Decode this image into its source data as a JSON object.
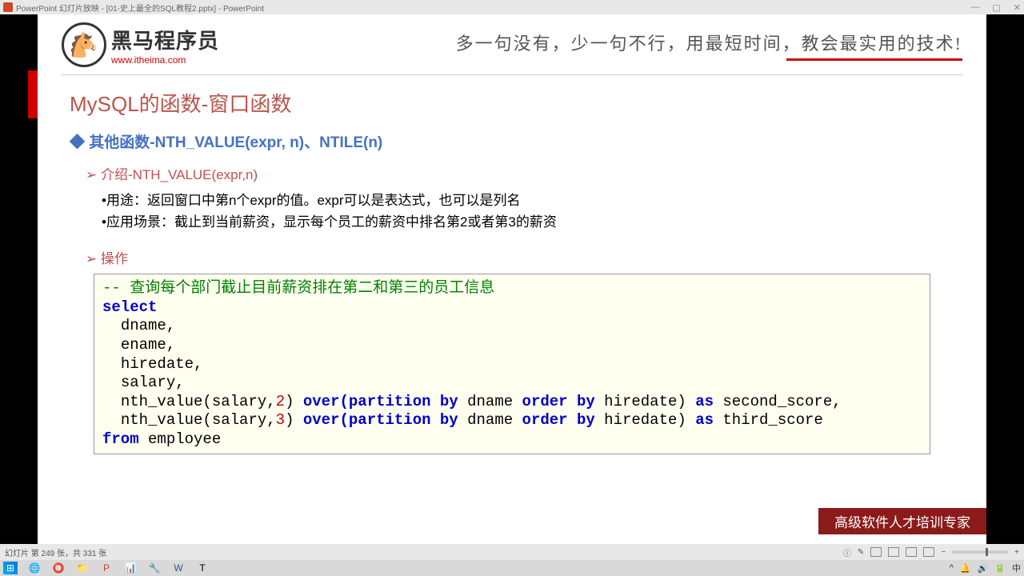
{
  "titlebar": {
    "app": "PowerPoint 幻灯片放映 - [01-史上最全的SQL教程2.pptx] - PowerPoint"
  },
  "logo": {
    "cn": "黑马程序员",
    "url": "www.itheima.com"
  },
  "tagline": "多一句没有，少一句不行，用最短时间，教会最实用的技术!",
  "slide": {
    "title": "MySQL的函数-窗口函数",
    "section": "其他函数-NTH_VALUE(expr, n)、NTILE(n)",
    "intro_label": "介绍-NTH_VALUE(expr,n)",
    "bullet1": "用途：返回窗口中第n个expr的值。expr可以是表达式，也可以是列名",
    "bullet2": "应用场景：截止到当前薪资，显示每个员工的薪资中排名第2或者第3的薪资",
    "op_label": "操作",
    "code": {
      "comment": "-- 查询每个部门截止目前薪资排在第二和第三的员工信息",
      "select": "select",
      "c1": "dname,",
      "c2": "ename,",
      "c3": "hiredate,",
      "c4": "salary,",
      "l5a": "nth_value(salary,",
      "l5n": "2",
      "l5b": ") ",
      "l5ov": "over",
      "l5p": "(",
      "l5pb": "partition by",
      "l5d": " dname ",
      "l5ob": "order by",
      "l5h": " hiredate) ",
      "l5as": "as",
      "l5s": " second_score,",
      "l6a": "nth_value(salary,",
      "l6n": "3",
      "l6b": ") ",
      "l6ov": "over",
      "l6p": "(",
      "l6pb": "partition by",
      "l6d": " dname ",
      "l6ob": "order by",
      "l6h": " hiredate) ",
      "l6as": "as",
      "l6s": " third_score",
      "from": "from",
      "tbl": " employee"
    }
  },
  "footer": "高级软件人才培训专家",
  "status": {
    "slide": "幻灯片 第 249 张，共 331 张"
  }
}
